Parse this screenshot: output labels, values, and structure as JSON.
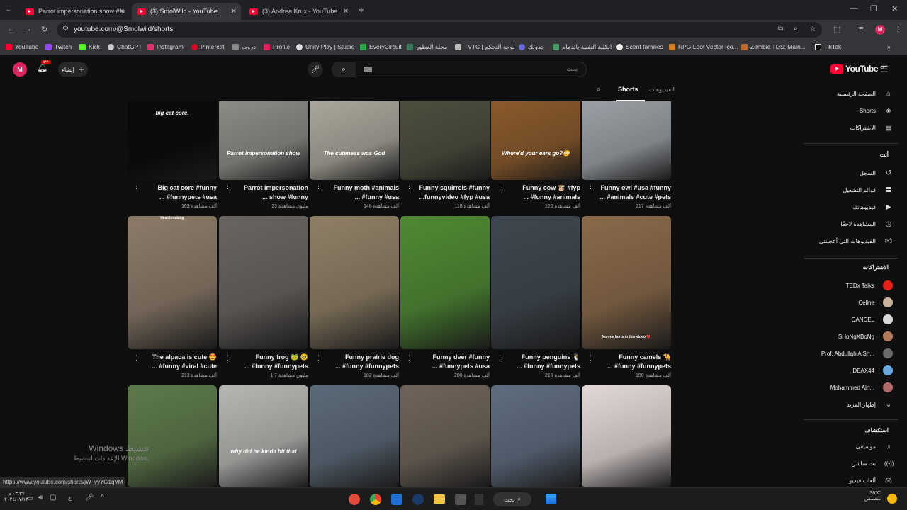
{
  "browser": {
    "tabs": [
      {
        "label": "Parrot impersonation show #fu"
      },
      {
        "label": "(3) SmolWild - YouTube"
      },
      {
        "label": "(3) Andrea Krux - YouTube"
      }
    ],
    "url": "youtube.com/@Smolwild/shorts",
    "bookmarks": [
      "YouTube",
      "Twitch",
      "Kick",
      "ChatGPT",
      "Instagram",
      "Pinterest",
      "دروب",
      "Profile",
      "Unity Play | Studio",
      "EveryCircuit",
      "مجلة العطور",
      "TVTC | لوحة التحكم",
      "جدولك",
      "الكلية التقنية بالدمام",
      "Scent families",
      "RPG Loot Vector Ico...",
      "Zombie TDS: Main...",
      "TikTok"
    ]
  },
  "yt": {
    "logo": "YouTube",
    "logo_region": "SA",
    "search_placeholder": "بحث",
    "create_label": "إنشاء",
    "notif_count": "9+",
    "avatar_letter": "M",
    "tabs": {
      "shorts": "Shorts",
      "videos": "الفيديوهات"
    }
  },
  "shorts_row1": [
    {
      "title1": "Big cat core #funny",
      "title2": "... #funnypets #usa",
      "views": "163 ألف مشاهدة",
      "overlay": "big cat core.",
      "color": "#0a0a0a"
    },
    {
      "title1": "Parrot impersonation",
      "title2": "... show #funny",
      "views": "23 مليون مشاهدة",
      "overlay": "Parrot impersonation show",
      "color": "#8c8c86"
    },
    {
      "title1": "Funny moth #animals",
      "title2": "... #funny #usa",
      "views": "148 ألف مشاهدة",
      "overlay": "The cuteness was God",
      "color": "#aaa69b"
    },
    {
      "title1": "Funny squirrels #funny",
      "title2": "...funnyvideo #fyp #usa",
      "views": "118 ألف مشاهدة",
      "overlay": "",
      "color": "#4d4e3d"
    },
    {
      "title1": "Funny cow 🐮 #fyp",
      "title2": "... #funny #animals",
      "views": "125 ألف مشاهدة",
      "overlay": "Where'd your ears go?😳",
      "color": "#8a5a2c"
    },
    {
      "title1": "Funny owl #usa #funny",
      "title2": "... #animals #cute #pets",
      "views": "217 ألف مشاهدة",
      "overlay": "",
      "color": "#9aa0a5"
    }
  ],
  "shorts_row2": [
    {
      "title1": "The alpaca is cute 🤩",
      "title2": "... #funny #viral #cute",
      "views": "213 ألف مشاهدة",
      "overlay": "Heartbreaking",
      "color": "#8c7b69"
    },
    {
      "title1": "Funny frog 🐸 🥺",
      "title2": "... #funny #funnypets",
      "views": "1.7 مليون مشاهدة",
      "overlay": "",
      "color": "#6a6560"
    },
    {
      "title1": "Funny prairie dog",
      "title2": "... #funny #funnypets",
      "views": "182 ألف مشاهدة",
      "overlay": "",
      "color": "#8f7f66"
    },
    {
      "title1": "Funny deer #funny",
      "title2": "... #funnypets #usa",
      "views": "208 ألف مشاهدة",
      "overlay": "",
      "color": "#4f8a34"
    },
    {
      "title1": "Funny penguins 🐧",
      "title2": "... #funny #funnypets",
      "views": "216 ألف مشاهدة",
      "overlay": "",
      "color": "#3f4850"
    },
    {
      "title1": "Funny camels 🐪",
      "title2": "... #funny #funnypets",
      "views": "150 ألف مشاهدة",
      "overlay": "No one hurts in this video 💔",
      "color": "#8a6a4a"
    }
  ],
  "shorts_row3": [
    {
      "overlay": "",
      "color": "#5d7a4c"
    },
    {
      "overlay": "why did he kinda hit that",
      "color": "#b6b6b2"
    },
    {
      "overlay": "",
      "color": "#5c6a79"
    },
    {
      "overlay": "",
      "color": "#6f6459"
    },
    {
      "overlay": "",
      "color": "#5f6d80"
    },
    {
      "overlay": "",
      "color": "#e3d8d6"
    }
  ],
  "sidebar": {
    "main": [
      "الصفحة الرئيسية",
      "Shorts",
      "الاشتراكات"
    ],
    "you_header": "أنت",
    "you": [
      "السجل",
      "قوائم التشغيل",
      "فيديوهاتك",
      "المشاهدة لاحقًا",
      "الفيديوهات التي أعجبتني"
    ],
    "subs_header": "الاشتراكات",
    "subs": [
      {
        "name": "TEDx Talks",
        "color": "#e62117"
      },
      {
        "name": "Celine",
        "color": "#c9b39a"
      },
      {
        "name": "CANCEL",
        "color": "#d8d8d8"
      },
      {
        "name": "SHoNgXBoNg",
        "color": "#b07a5a"
      },
      {
        "name": "Prof. Abdullah AlSh...",
        "color": "#6a6a6a"
      },
      {
        "name": "DEAX44",
        "color": "#6aa8e0"
      },
      {
        "name": "Mohammed Aln...",
        "color": "#b06a6a"
      }
    ],
    "show_more": "إظهار المزيد",
    "explore_header": "استكشاف",
    "explore": [
      "موسيقى",
      "بث مباشر",
      "ألعاب فيديو"
    ]
  },
  "status_url": "https://www.youtube.com/shorts/jW_yyYG1qVM",
  "windows_watermark": {
    "line1": "Windows تنشيط",
    "line2": "الإعدادات لتنشيط Windows."
  },
  "taskbar": {
    "search": "بحث",
    "temp": "36°C",
    "weather": "مشمس",
    "time": "٠٣:٣٧ م",
    "date": "٢٠٢٤/٠٧/١٣"
  }
}
